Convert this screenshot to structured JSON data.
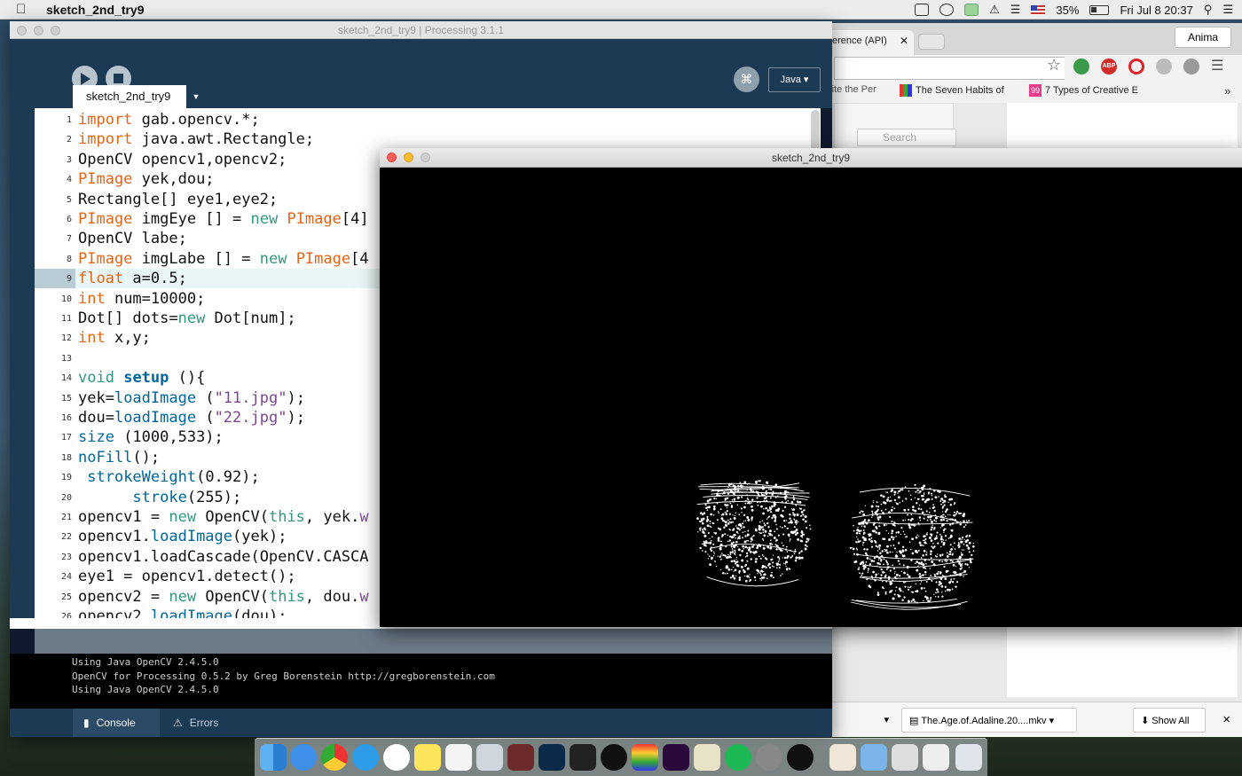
{
  "menubar": {
    "app_name": "sketch_2nd_try9",
    "battery": "35%",
    "clock": "Fri Jul 8  20:37"
  },
  "chrome": {
    "tab_title": "erence (API)",
    "profile_name": "Anima",
    "bookmarks": [
      "rite the Per",
      "The Seven Habits of",
      "7 Types of Creative E"
    ],
    "bookmark_badge": "99",
    "search_placeholder": "Search",
    "download_file": "The.Age.of.Adaline.20....mkv",
    "show_all": "Show All",
    "more_bookmarks": "»"
  },
  "ide": {
    "window_title": "sketch_2nd_try9 | Processing 3.1.1",
    "mode": "Java",
    "sketch_tab": "sketch_2nd_try9",
    "code_lines": [
      [
        {
          "t": "import",
          "c": "kw"
        },
        {
          "t": " gab.opencv.*;"
        }
      ],
      [
        {
          "t": "import",
          "c": "kw"
        },
        {
          "t": " java.awt.Rectangle;"
        }
      ],
      [
        {
          "t": "OpenCV opencv1,opencv2;"
        }
      ],
      [
        {
          "t": "PImage",
          "c": "kw"
        },
        {
          "t": " yek,dou;"
        }
      ],
      [
        {
          "t": "Rectangle[] eye1,eye2;"
        }
      ],
      [
        {
          "t": "PImage",
          "c": "kw"
        },
        {
          "t": " imgEye [] = "
        },
        {
          "t": "new",
          "c": "gr"
        },
        {
          "t": " "
        },
        {
          "t": "PImage",
          "c": "kw"
        },
        {
          "t": "[4]"
        }
      ],
      [
        {
          "t": "OpenCV labe;"
        }
      ],
      [
        {
          "t": "PImage",
          "c": "kw"
        },
        {
          "t": " imgLabe [] = "
        },
        {
          "t": "new",
          "c": "gr"
        },
        {
          "t": " "
        },
        {
          "t": "PImage",
          "c": "kw"
        },
        {
          "t": "[4"
        }
      ],
      [
        {
          "t": "float",
          "c": "kw"
        },
        {
          "t": " a=0.5;"
        }
      ],
      [
        {
          "t": "int",
          "c": "kw"
        },
        {
          "t": " num=10000;"
        }
      ],
      [
        {
          "t": "Dot[] dots="
        },
        {
          "t": "new",
          "c": "gr"
        },
        {
          "t": " Dot[num];"
        }
      ],
      [
        {
          "t": "int",
          "c": "kw"
        },
        {
          "t": " x,y;"
        }
      ],
      [],
      [
        {
          "t": "void",
          "c": "gr"
        },
        {
          "t": " "
        },
        {
          "t": "setup",
          "c": "bd"
        },
        {
          "t": " (){"
        }
      ],
      [
        {
          "t": "yek="
        },
        {
          "t": "loadImage",
          "c": "fn"
        },
        {
          "t": " ("
        },
        {
          "t": "\"11.jpg\"",
          "c": "st"
        },
        {
          "t": ");"
        }
      ],
      [
        {
          "t": "dou="
        },
        {
          "t": "loadImage",
          "c": "fn"
        },
        {
          "t": " ("
        },
        {
          "t": "\"22.jpg\"",
          "c": "st"
        },
        {
          "t": ");"
        }
      ],
      [
        {
          "t": "size",
          "c": "fn"
        },
        {
          "t": " (1000,533);"
        }
      ],
      [
        {
          "t": "noFill",
          "c": "fn"
        },
        {
          "t": "();"
        }
      ],
      [
        {
          "t": " "
        },
        {
          "t": "strokeWeight",
          "c": "fn"
        },
        {
          "t": "(0.92);"
        }
      ],
      [
        {
          "t": "      "
        },
        {
          "t": "stroke",
          "c": "fn"
        },
        {
          "t": "(255);"
        }
      ],
      [
        {
          "t": "opencv1 = "
        },
        {
          "t": "new",
          "c": "gr"
        },
        {
          "t": " OpenCV("
        },
        {
          "t": "this",
          "c": "gr"
        },
        {
          "t": ", yek."
        },
        {
          "t": "w",
          "c": "st"
        }
      ],
      [
        {
          "t": "opencv1."
        },
        {
          "t": "loadImage",
          "c": "fn"
        },
        {
          "t": "(yek);"
        }
      ],
      [
        {
          "t": "opencv1.loadCascade(OpenCV.CASCA"
        }
      ],
      [
        {
          "t": "eye1 = opencv1.detect();"
        }
      ],
      [
        {
          "t": "opencv2 = "
        },
        {
          "t": "new",
          "c": "gr"
        },
        {
          "t": " OpenCV("
        },
        {
          "t": "this",
          "c": "gr"
        },
        {
          "t": ", dou."
        },
        {
          "t": "w",
          "c": "st"
        }
      ],
      [
        {
          "t": "opencv2."
        },
        {
          "t": "loadImage",
          "c": "fn"
        },
        {
          "t": "(dou);"
        }
      ]
    ],
    "console_lines": [
      "Using Java OpenCV 2.4.5.0",
      "OpenCV for Processing 0.5.2 by Greg Borenstein http://gregborenstein.com",
      "Using Java OpenCV 2.4.5.0"
    ],
    "console_tab": "Console",
    "errors_tab": "Errors"
  },
  "sketch_window": {
    "title": "sketch_2nd_try9"
  }
}
